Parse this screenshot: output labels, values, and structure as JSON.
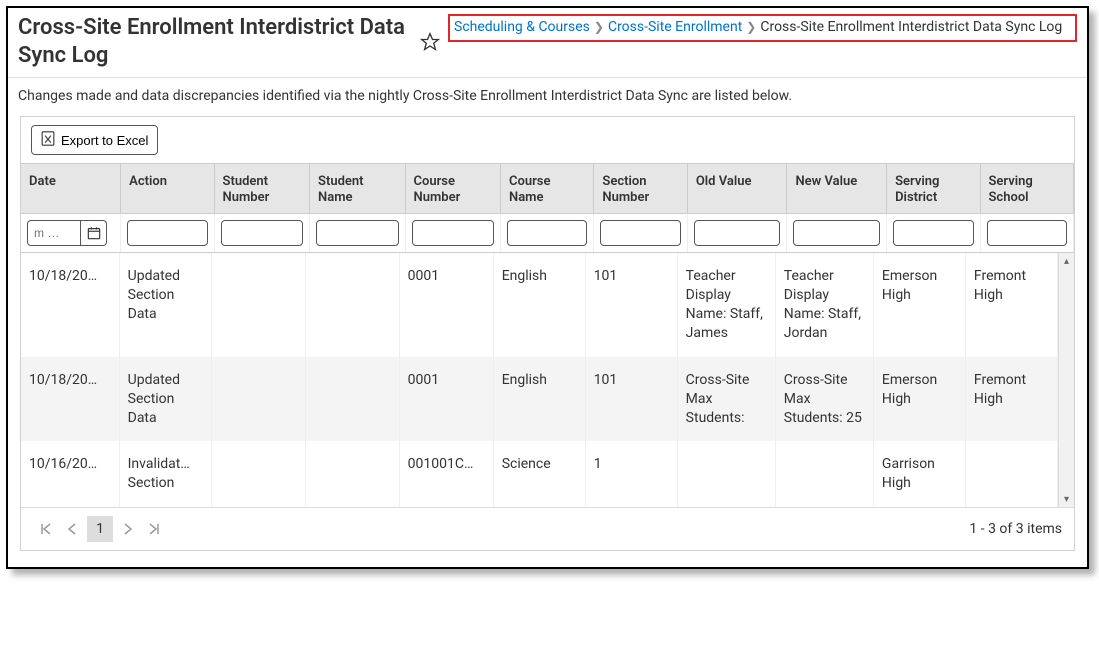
{
  "page_title": "Cross-Site Enrollment Interdistrict Data Sync Log",
  "breadcrumb": {
    "items": [
      {
        "label": "Scheduling & Courses",
        "link": true
      },
      {
        "label": "Cross-Site Enrollment",
        "link": true
      },
      {
        "label": "Cross-Site Enrollment Interdistrict Data Sync Log",
        "link": false
      }
    ]
  },
  "intro_text": "Changes made and data discrepancies identified via the nightly Cross-Site Enrollment Interdistrict Data Sync are listed below.",
  "toolbar": {
    "export_label": "Export to Excel"
  },
  "columns": [
    "Date",
    "Action",
    "Student Number",
    "Student Name",
    "Course Number",
    "Course Name",
    "Section Number",
    "Old Value",
    "New Value",
    "Serving District",
    "Serving School"
  ],
  "date_filter_placeholder": "m …",
  "rows": [
    {
      "date": "10/18/20…",
      "action": "Updated Section Data",
      "student_number": "",
      "student_name": "",
      "course_number": "0001",
      "course_name": "English",
      "section_number": "101",
      "old_value": "Teacher Display Name: Staff, James",
      "new_value": "Teacher Display Name: Staff, Jordan",
      "serving_district": "Emerson High",
      "serving_school": "Fremont High"
    },
    {
      "date": "10/18/20…",
      "action": "Updated Section Data",
      "student_number": "",
      "student_name": "",
      "course_number": "0001",
      "course_name": "English",
      "section_number": "101",
      "old_value": "Cross-Site Max Students:",
      "new_value": "Cross-Site Max Students: 25",
      "serving_district": "Emerson High",
      "serving_school": "Fremont High"
    },
    {
      "date": "10/16/20…",
      "action": "Invalidat… Section",
      "student_number": "",
      "student_name": "",
      "course_number": "001001C…",
      "course_name": "Science",
      "section_number": "1",
      "old_value": "",
      "new_value": "",
      "serving_district": "Garrison High",
      "serving_school": ""
    }
  ],
  "pager": {
    "current_page": "1",
    "status": "1 - 3 of 3 items"
  }
}
